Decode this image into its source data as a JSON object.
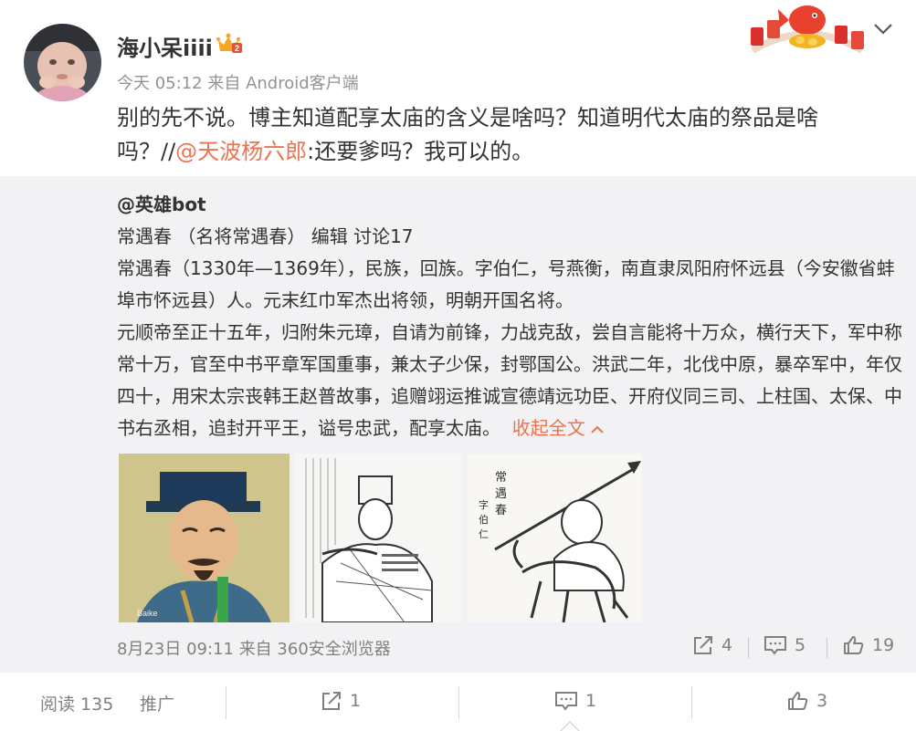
{
  "author": {
    "name": "海小呆iiii",
    "vip_badge": "vip-crown-icon",
    "time": "今天 05:12",
    "source": "来自 Android客户端"
  },
  "post": {
    "text": "别的先不说。博主知道配享太庙的含义是啥吗？知道明代太庙的祭品是啥吗？//",
    "mention": "@天波杨六郎",
    "text2": ":还要爹吗？我可以的。"
  },
  "repost": {
    "user": "@英雄bot",
    "lines": [
      "常遇春 （名将常遇春） 编辑 讨论17",
      "常遇春（1330年—1369年），民族，回族。字伯仁，号燕衡，南直隶凤阳府怀远县（今安徽省蚌埠市怀远县）人。元末红巾军杰出将领，明朝开国名将。",
      "元顺帝至正十五年，归附朱元璋，自请为前锋，力战克敌，尝自言能将十万众，横行天下，军中称常十万，官至中书平章军国重事，兼太子少保，封鄂国公。洪武二年，北伐中原，暴卒军中，年仅四十，用宋太宗丧韩王赵普故事，追赠翊运推诚宣德靖远功臣、开府仪同三司、上柱国、太保、中书右丞相，追封开平王，谥号忠武，配享太庙。"
    ],
    "collapse_label": "收起全文",
    "images": [
      {
        "name": "portrait-painting",
        "watermark": "Baike"
      },
      {
        "name": "woodcut-illustration",
        "watermark": ""
      },
      {
        "name": "ink-rider-illustration",
        "caption_chars": [
          "常",
          "遇",
          "春",
          "字",
          "伯",
          "仁"
        ]
      }
    ],
    "date": "8月23日 09:11",
    "source": "来自 360安全浏览器",
    "share_count": "4",
    "comment_count": "5",
    "like_count": "19"
  },
  "footer": {
    "read_label": "阅读 135",
    "promote_label": "推广",
    "share_count": "1",
    "comment_count": "1",
    "like_count": "3"
  },
  "colors": {
    "link": "#eb7350",
    "repost_bg": "#f2f2f5",
    "meta_text": "#939393"
  }
}
